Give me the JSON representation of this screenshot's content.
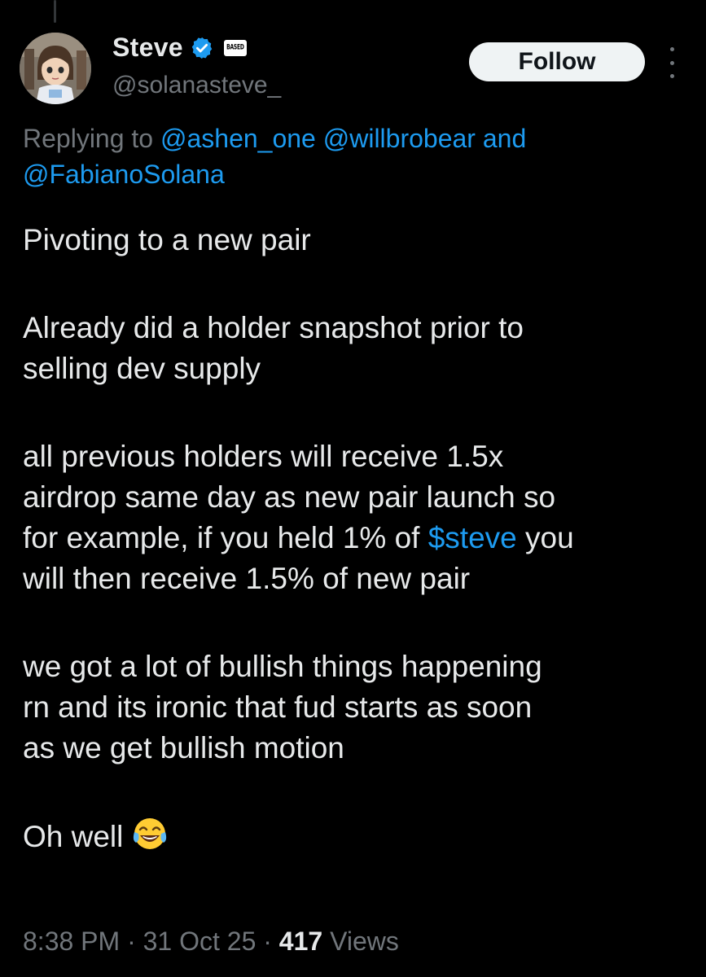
{
  "author": {
    "display_name": "Steve",
    "handle": "@solanasteve_",
    "affiliate_badge_text": "BASED"
  },
  "follow_label": "Follow",
  "reply_context": {
    "prefix": "Replying to",
    "mentions": [
      "@ashen_one",
      "@willbrobear"
    ],
    "conjunction": "and",
    "last_mention": "@FabianoSolana"
  },
  "body": {
    "p1": "Pivoting to a new pair",
    "p2": "Already did a holder snapshot prior to\nselling dev supply",
    "p3_before": "all previous holders will receive 1.5x\nairdrop same day as new pair launch so\nfor example, if you held 1% of ",
    "p3_cashtag": "$steve",
    "p3_after": " you\nwill then receive 1.5% of new pair",
    "p4": "we got a lot of bullish things happening\nrn and its ironic that fud starts as soon\nas we get bullish motion",
    "p5": "Oh well",
    "p5_emoji": "face-with-tears-of-joy"
  },
  "meta": {
    "time": "8:38 PM",
    "separator": "·",
    "date": "31 Oct 25",
    "views_count": "417",
    "views_label": "Views"
  },
  "colors": {
    "background": "#000000",
    "text": "#e7e9ea",
    "secondary": "#71767b",
    "link": "#1d9bf0",
    "follow_bg": "#eff3f4"
  }
}
